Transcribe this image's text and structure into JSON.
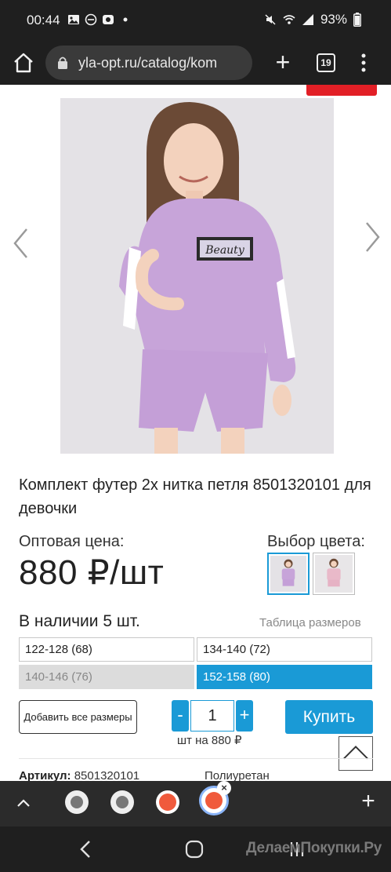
{
  "status_bar": {
    "time": "00:44",
    "battery": "93%",
    "icons": [
      "image-icon",
      "minus-circle-icon",
      "record-icon",
      "dot-icon",
      "mute-icon",
      "wifi-icon",
      "signal-icon",
      "battery-icon"
    ]
  },
  "browser": {
    "url": "yla-opt.ru/catalog/kom",
    "tab_count": "19"
  },
  "product": {
    "title": "Комплект футер 2х нитка петля 8501320101 для девочки",
    "price_label": "Оптовая цена:",
    "price": "880 ₽/шт",
    "color_label": "Выбор цвета:",
    "image_print": "Beauty",
    "stock": "В наличии 5 шт.",
    "size_table_link": "Таблица размеров",
    "sizes": [
      {
        "label": "122-128 (68)",
        "state": "available"
      },
      {
        "label": "134-140 (72)",
        "state": "available"
      },
      {
        "label": "140-146 (76)",
        "state": "disabled"
      },
      {
        "label": "152-158 (80)",
        "state": "selected"
      }
    ],
    "add_all_sizes": "Добавить все размеры",
    "qty_minus": "-",
    "quantity": "1",
    "qty_plus": "+",
    "per_price": "шт на 880 ₽",
    "buy_label": "Купить",
    "article_label": "Артикул:",
    "article_value": "8501320101",
    "material": "Полиуретан"
  },
  "bubbles": {
    "close_symbol": "×",
    "add_symbol": "+"
  },
  "watermark": "ДелаемПокупки.Ру",
  "colors": {
    "accent": "#1a9ad6",
    "brand_red": "#e21f26",
    "lilac": "#c7a4d9",
    "pink": "#e9b9c9"
  }
}
